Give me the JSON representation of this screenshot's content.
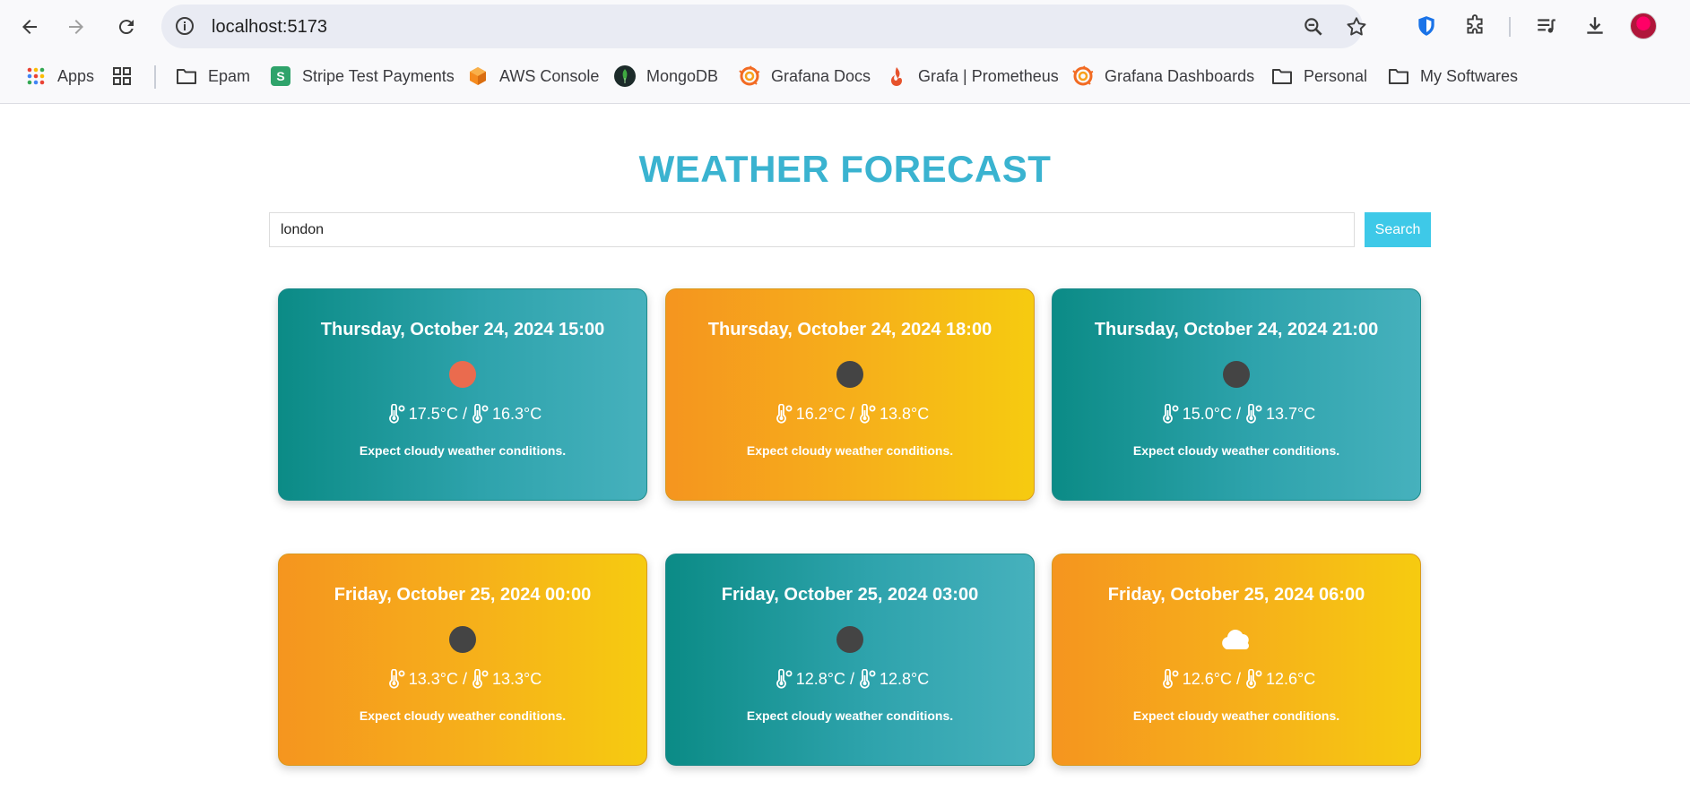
{
  "browser": {
    "url": "localhost:5173",
    "bookmarks": [
      {
        "label": "Apps",
        "icon": "apps-grid-icon"
      },
      {
        "label": "",
        "icon": "grid-icon"
      },
      {
        "label": "Epam",
        "icon": "folder-icon"
      },
      {
        "label": "Stripe Test Payments",
        "icon": "stripe-icon"
      },
      {
        "label": "AWS Console",
        "icon": "aws-icon"
      },
      {
        "label": "MongoDB",
        "icon": "mongodb-icon"
      },
      {
        "label": "Grafana Docs",
        "icon": "grafana-icon"
      },
      {
        "label": "Grafa | Prometheus",
        "icon": "prometheus-icon"
      },
      {
        "label": "Grafana Dashboards",
        "icon": "grafana-icon"
      },
      {
        "label": "Personal",
        "icon": "folder-icon"
      },
      {
        "label": "My Softwares",
        "icon": "folder-icon"
      }
    ]
  },
  "page": {
    "title": "WEATHER FORECAST",
    "search": {
      "value": "london",
      "button_label": "Search"
    },
    "colors": {
      "title": "#3ab3d0",
      "search_button": "#3ec9e8",
      "teal": "#0b8b86",
      "orange": "#f5951f"
    },
    "forecasts": [
      {
        "date": "Thursday, October 24, 2024 15:00",
        "icon": "sun-dot-icon",
        "icon_color": "#ea6b4e",
        "temp_max": "17.5°C",
        "temp_min": "16.3°C",
        "description": "Expect cloudy weather conditions.",
        "theme": "teal"
      },
      {
        "date": "Thursday, October 24, 2024 18:00",
        "icon": "night-dot-icon",
        "icon_color": "#444444",
        "temp_max": "16.2°C",
        "temp_min": "13.8°C",
        "description": "Expect cloudy weather conditions.",
        "theme": "orange"
      },
      {
        "date": "Thursday, October 24, 2024 21:00",
        "icon": "night-dot-icon",
        "icon_color": "#444444",
        "temp_max": "15.0°C",
        "temp_min": "13.7°C",
        "description": "Expect cloudy weather conditions.",
        "theme": "teal"
      },
      {
        "date": "Friday, October 25, 2024 00:00",
        "icon": "night-dot-icon",
        "icon_color": "#444444",
        "temp_max": "13.3°C",
        "temp_min": "13.3°C",
        "description": "Expect cloudy weather conditions.",
        "theme": "orange"
      },
      {
        "date": "Friday, October 25, 2024 03:00",
        "icon": "night-dot-icon",
        "icon_color": "#444444",
        "temp_max": "12.8°C",
        "temp_min": "12.8°C",
        "description": "Expect cloudy weather conditions.",
        "theme": "teal"
      },
      {
        "date": "Friday, October 25, 2024 06:00",
        "icon": "cloud-icon",
        "icon_color": "#ffffff",
        "temp_max": "12.6°C",
        "temp_min": "12.6°C",
        "description": "Expect cloudy weather conditions.",
        "theme": "orange"
      }
    ]
  }
}
